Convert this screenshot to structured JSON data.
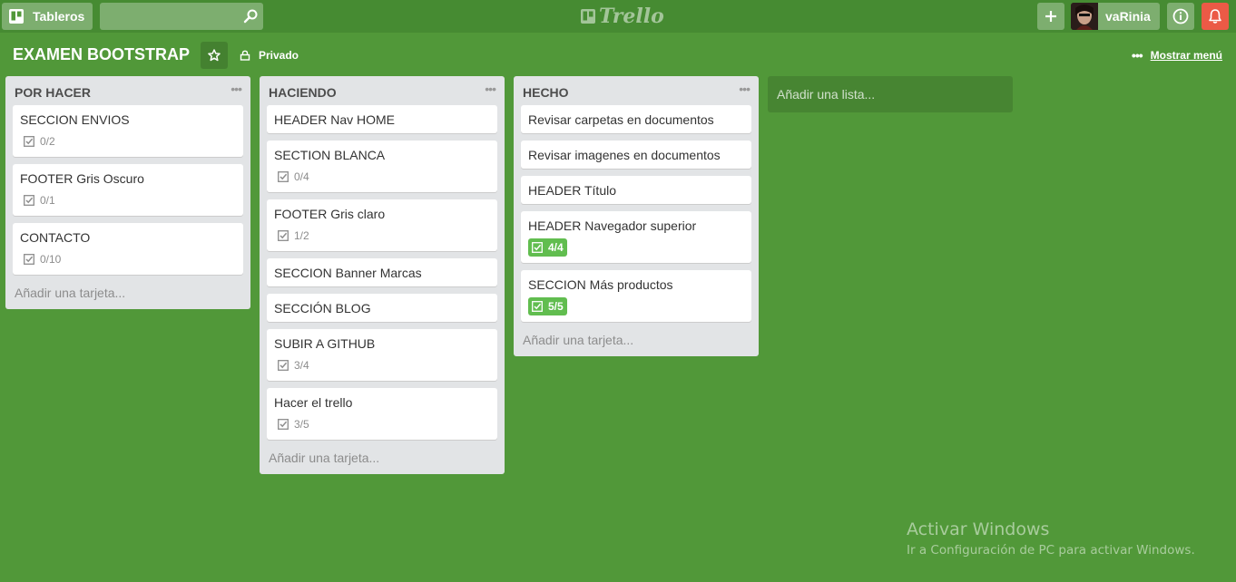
{
  "header": {
    "boards_label": "Tableros",
    "search_value": "",
    "logo_text": "Trello",
    "username": "vaRinia"
  },
  "board": {
    "title": "EXAMEN BOOTSTRAP",
    "privacy": "Privado",
    "show_menu": "Mostrar menú",
    "add_list": "Añadir una lista..."
  },
  "lists": [
    {
      "title": "POR HACER",
      "add_card": "Añadir una tarjeta...",
      "cards": [
        {
          "title": "SECCION ENVIOS",
          "checklist": "0/2",
          "done": false
        },
        {
          "title": "FOOTER Gris Oscuro",
          "checklist": "0/1",
          "done": false
        },
        {
          "title": "CONTACTO",
          "checklist": "0/10",
          "done": false
        }
      ]
    },
    {
      "title": "HACIENDO",
      "add_card": "Añadir una tarjeta...",
      "cards": [
        {
          "title": "HEADER Nav HOME",
          "checklist": null,
          "done": false
        },
        {
          "title": "SECTION BLANCA",
          "checklist": "0/4",
          "done": false
        },
        {
          "title": "FOOTER Gris claro",
          "checklist": "1/2",
          "done": false
        },
        {
          "title": "SECCION Banner Marcas",
          "checklist": null,
          "done": false
        },
        {
          "title": "SECCIÓN BLOG",
          "checklist": null,
          "done": false
        },
        {
          "title": "SUBIR A GITHUB",
          "checklist": "3/4",
          "done": false
        },
        {
          "title": "Hacer el trello",
          "checklist": "3/5",
          "done": false
        }
      ]
    },
    {
      "title": "HECHO",
      "add_card": "Añadir una tarjeta...",
      "cards": [
        {
          "title": "Revisar carpetas en documentos",
          "checklist": null,
          "done": false
        },
        {
          "title": "Revisar imagenes en documentos",
          "checklist": null,
          "done": false
        },
        {
          "title": "HEADER Título",
          "checklist": null,
          "done": false
        },
        {
          "title": "HEADER Navegador superior",
          "checklist": "4/4",
          "done": true
        },
        {
          "title": "SECCION Más productos",
          "checklist": "5/5",
          "done": true
        }
      ]
    }
  ],
  "watermark": {
    "title": "Activar Windows",
    "subtitle": "Ir a Configuración de PC para activar Windows."
  },
  "colors": {
    "board_bg": "#519839",
    "header_bg": "#468b32",
    "checklist_done": "#61bd4f",
    "notification": "#eb5a46"
  }
}
